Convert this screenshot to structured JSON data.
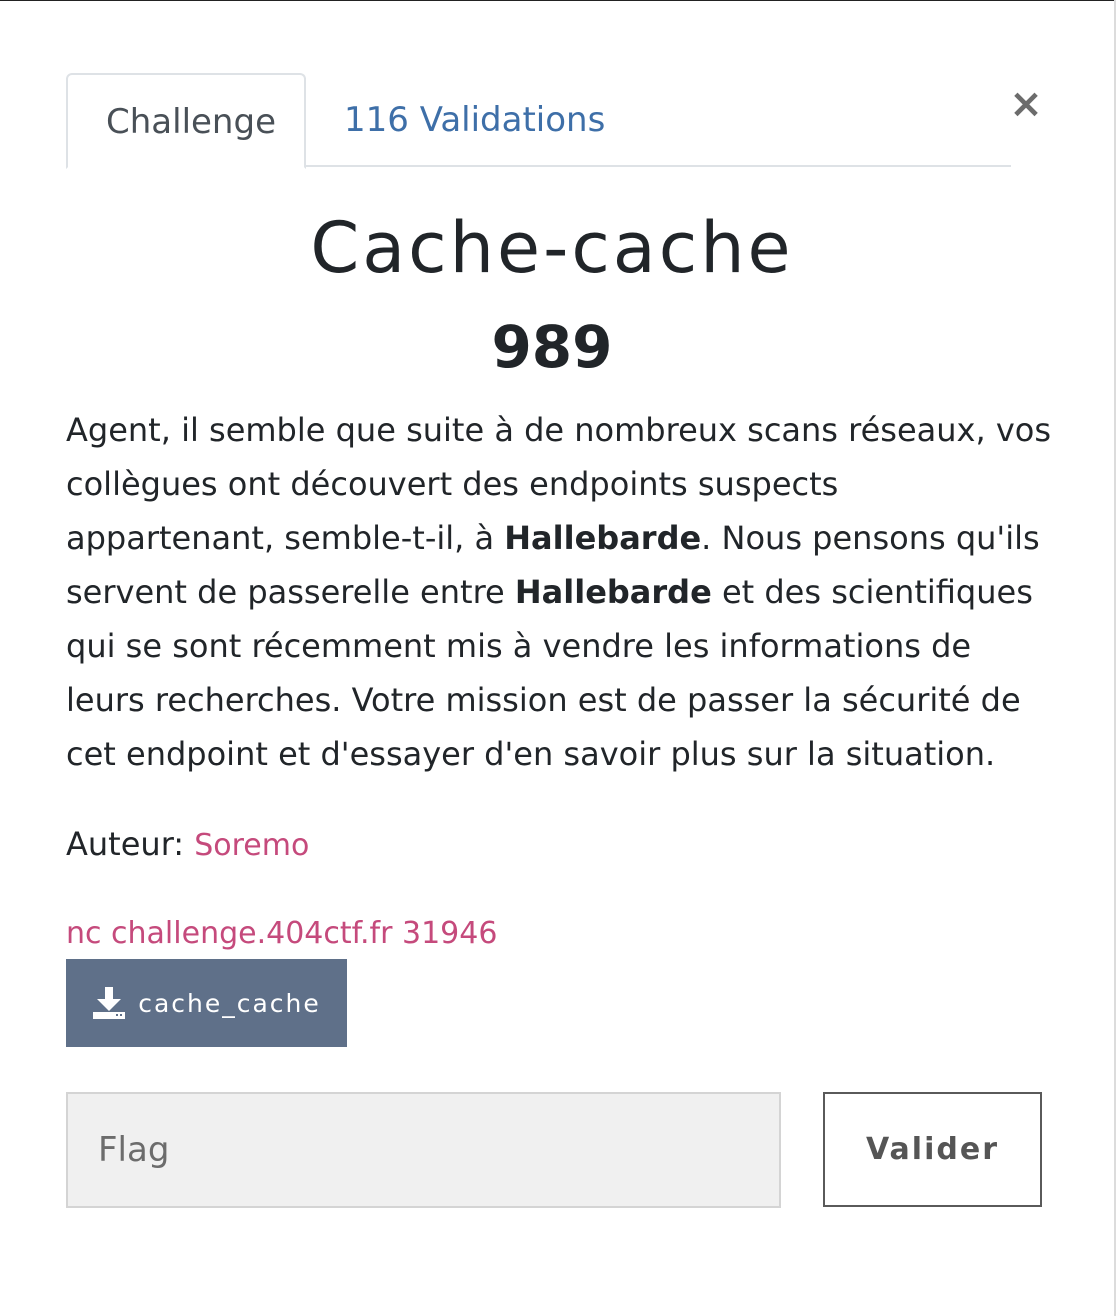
{
  "modal": {
    "close_glyph": "×"
  },
  "tabs": {
    "challenge_label": "Challenge",
    "validations_label": "116 Validations"
  },
  "challenge": {
    "title": "Cache-cache",
    "points": "989",
    "description": {
      "part1": "Agent, il semble que suite à de nombreux scans réseaux, vos collègues ont découvert des endpoints suspects appartenant, semble-t-il, à ",
      "bold1": "Hallebarde",
      "part2": ". Nous pensons qu'ils servent de passerelle entre ",
      "bold2": "Hallebarde",
      "part3": " et des scientifiques qui se sont récemment mis à vendre les informations de leurs recherches. Votre mission est de passer la sécurité de cet endpoint et d'essayer d'en savoir plus sur la situation."
    },
    "author_label": "Auteur:",
    "author_name": "Soremo",
    "connection": "nc challenge.404ctf.fr 31946",
    "download_label": "cache_cache"
  },
  "form": {
    "flag_placeholder": "Flag",
    "submit_label": "Valider"
  },
  "colors": {
    "link_blue": "#3e6fa8",
    "accent_pink": "#c54a7c",
    "download_button": "#5f7089"
  },
  "icons": {
    "download": "download-icon",
    "close": "close-icon"
  }
}
